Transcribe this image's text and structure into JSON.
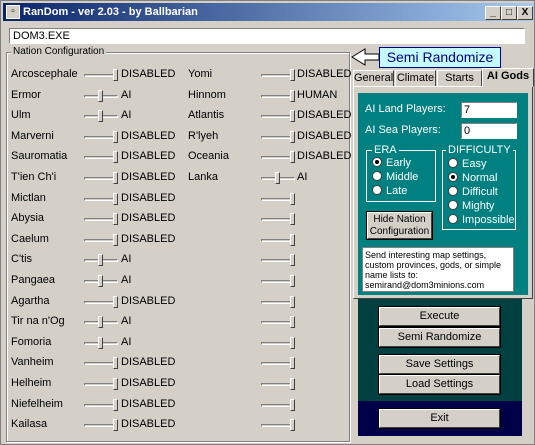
{
  "window": {
    "title": "RanDom - ver 2.03 - by Ballbarian",
    "controls": [
      "_",
      "□",
      "X"
    ]
  },
  "path_field": {
    "value": "DOM3.EXE"
  },
  "nation_config": {
    "title": "Nation Configuration",
    "left": [
      {
        "name": "Arcoscephale",
        "value": "DISABLED"
      },
      {
        "name": "Ermor",
        "value": "AI"
      },
      {
        "name": "Ulm",
        "value": "AI"
      },
      {
        "name": "Marverni",
        "value": "DISABLED"
      },
      {
        "name": "Sauromatia",
        "value": "DISABLED"
      },
      {
        "name": "T'ien Ch'i",
        "value": "DISABLED"
      },
      {
        "name": "Mictlan",
        "value": "DISABLED"
      },
      {
        "name": "Abysia",
        "value": "DISABLED"
      },
      {
        "name": "Caelum",
        "value": "DISABLED"
      },
      {
        "name": "C'tis",
        "value": "AI"
      },
      {
        "name": "Pangaea",
        "value": "AI"
      },
      {
        "name": "Agartha",
        "value": "DISABLED"
      },
      {
        "name": "Tir na n'Og",
        "value": "AI"
      },
      {
        "name": "Fomoria",
        "value": "AI"
      },
      {
        "name": "Vanheim",
        "value": "DISABLED"
      },
      {
        "name": "Helheim",
        "value": "DISABLED"
      },
      {
        "name": "Niefelheim",
        "value": "DISABLED"
      },
      {
        "name": "Kailasa",
        "value": "DISABLED"
      }
    ],
    "right": [
      {
        "name": "Yomi",
        "value": "DISABLED"
      },
      {
        "name": "Hinnom",
        "value": "HUMAN"
      },
      {
        "name": "Atlantis",
        "value": "DISABLED"
      },
      {
        "name": "R'lyeh",
        "value": "DISABLED"
      },
      {
        "name": "Oceania",
        "value": "DISABLED"
      },
      {
        "name": "Lanka",
        "value": "AI"
      },
      {
        "name": "",
        "value": ""
      },
      {
        "name": "",
        "value": ""
      },
      {
        "name": "",
        "value": ""
      },
      {
        "name": "",
        "value": ""
      },
      {
        "name": "",
        "value": ""
      },
      {
        "name": "",
        "value": ""
      },
      {
        "name": "",
        "value": ""
      },
      {
        "name": "",
        "value": ""
      },
      {
        "name": "",
        "value": ""
      },
      {
        "name": "",
        "value": ""
      },
      {
        "name": "",
        "value": ""
      },
      {
        "name": "",
        "value": ""
      }
    ]
  },
  "banner": {
    "label": "Semi Randomize"
  },
  "tabs": [
    {
      "label": "General"
    },
    {
      "label": "Climate"
    },
    {
      "label": "Starts"
    },
    {
      "label": "AI Gods",
      "active": true
    }
  ],
  "ai_gods": {
    "land_label": "AI Land Players:",
    "land_value": "7",
    "sea_label": "AI Sea Players:",
    "sea_value": "0",
    "era": {
      "title": "ERA",
      "options": [
        "Early",
        "Middle",
        "Late"
      ],
      "selected": "Early"
    },
    "difficulty": {
      "title": "DIFFICULTY",
      "options": [
        "Easy",
        "Normal",
        "Difficult",
        "Mighty",
        "Impossible"
      ],
      "selected": "Normal"
    },
    "hide_button": "Hide Nation Configuration",
    "info_text": "Send interesting map settings, custom provinces, gods, or simple name lists to: semirand@dom3minions.com"
  },
  "actions": {
    "execute": "Execute",
    "semi_randomize": "Semi Randomize",
    "save": "Save Settings",
    "load": "Load Settings",
    "exit": "Exit"
  }
}
